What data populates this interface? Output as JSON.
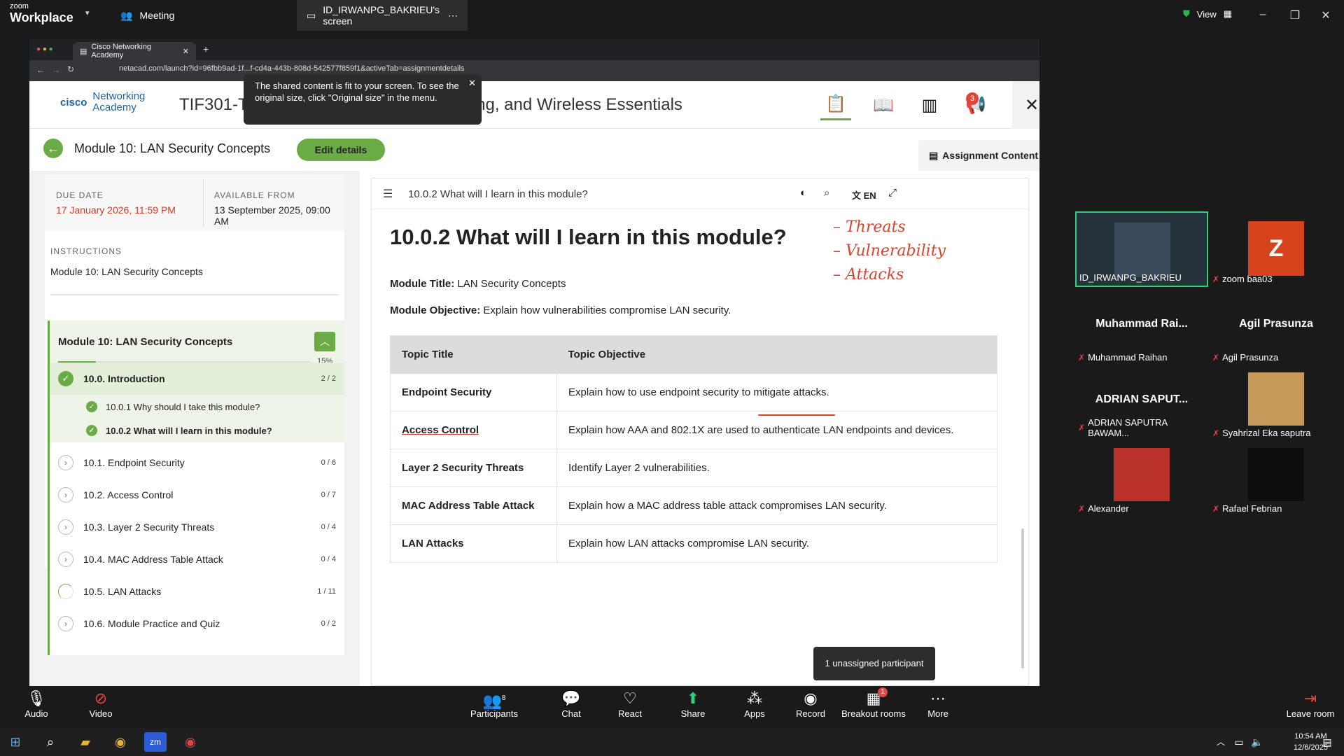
{
  "zoom": {
    "brand_line1": "zoom",
    "brand_line2": "Workplace",
    "tab_meeting": "Meeting",
    "tab_share": "ID_IRWANPG_BAKRIEU's screen",
    "view_label": "View",
    "tooltip": "The shared content is fit to your screen. To see the original size, click \"Original size\" in the menu.",
    "unassigned": "1 unassigned participant",
    "participants_count": "8",
    "breakout_badge": "1",
    "toolbar": {
      "audio": "Audio",
      "video": "Video",
      "participants": "Participants",
      "chat": "Chat",
      "react": "React",
      "share": "Share",
      "apps": "Apps",
      "record": "Record",
      "breakout": "Breakout rooms",
      "more": "More",
      "leave": "Leave room"
    },
    "gallery": [
      {
        "name": "ID_IRWANPG_BAKRIEU",
        "big": ""
      },
      {
        "name": "zoom baa03",
        "big": "Z"
      },
      {
        "name": "Muhammad Raihan",
        "big": "Muhammad Rai..."
      },
      {
        "name": "Agil Prasunza",
        "big": "Agil Prasunza"
      },
      {
        "name": "ADRIAN SAPUTRA BAWAM...",
        "big": "ADRIAN SAPUT..."
      },
      {
        "name": "Syahrizal Eka saputra",
        "big": ""
      },
      {
        "name": "Alexander",
        "big": ""
      },
      {
        "name": "Rafael Febrian",
        "big": ""
      }
    ]
  },
  "browser": {
    "tab_title": "Cisco Networking Academy",
    "url": "netacad.com/launch?id=96fbb9ad-1f...f-cd4a-443b-808d-542577f859f1&activeTab=assignmentdetails"
  },
  "page": {
    "logo_text": "Networking Academy",
    "logo_brand": "cisco",
    "course_title": "TIF301-TIF51X-CCNA: Switching, Routing, and Wireless Essentials",
    "notif_count": "3",
    "module_title": "Module 10: LAN Security Concepts",
    "edit_button": "Edit details",
    "assignment_tab": "Assignment Content",
    "due_label": "DUE DATE",
    "due_value": "17 January 2026, 11:59 PM",
    "avail_label": "AVAILABLE FROM",
    "avail_value": "13 September 2025, 09:00 AM",
    "instructions_label": "INSTRUCTIONS",
    "instructions_value": "Module 10: LAN Security Concepts",
    "box_title": "Module 10: LAN Security Concepts",
    "progress_pct": "15%",
    "progress": 0.15,
    "sections": [
      {
        "label": "10.0. Introduction",
        "count": "2 / 2"
      },
      {
        "label": "10.1. Endpoint Security",
        "count": "0 / 6"
      },
      {
        "label": "10.2. Access Control",
        "count": "0 / 7"
      },
      {
        "label": "10.3. Layer 2 Security Threats",
        "count": "0 / 4"
      },
      {
        "label": "10.4. MAC Address Table Attack",
        "count": "0 / 4"
      },
      {
        "label": "10.5. LAN Attacks",
        "count": "1 / 11"
      },
      {
        "label": "10.6. Module Practice and Quiz",
        "count": "0 / 2"
      }
    ],
    "subitems": [
      {
        "label": "10.0.1 Why should I take this module?"
      },
      {
        "label": "10.0.2 What will I learn in this module?"
      }
    ]
  },
  "content": {
    "toolbar_title": "10.0.2 What will I learn in this module?",
    "lang": "EN",
    "heading": "10.0.2 What will I learn in this module?",
    "module_title_label": "Module Title:",
    "module_title_value": "LAN Security Concepts",
    "module_obj_label": "Module Objective:",
    "module_obj_value": "Explain how vulnerabilities compromise LAN security.",
    "table": {
      "headers": [
        "Topic Title",
        "Topic Objective"
      ],
      "rows": [
        [
          "Endpoint Security",
          "Explain how to use endpoint security to mitigate attacks."
        ],
        [
          "Access Control",
          "Explain how AAA and 802.1X are used to authenticate LAN endpoints and devices."
        ],
        [
          "Layer 2 Security Threats",
          "Identify Layer 2 vulnerabilities."
        ],
        [
          "MAC Address Table Attack",
          "Explain how a MAC address table attack compromises LAN security."
        ],
        [
          "LAN Attacks",
          "Explain how LAN attacks compromise LAN security."
        ]
      ]
    },
    "annotations": [
      "– Threats",
      "– Vulnerability",
      "– Attacks"
    ]
  },
  "taskbar": {
    "time": "10:54 AM",
    "date": "12/6/2025"
  }
}
